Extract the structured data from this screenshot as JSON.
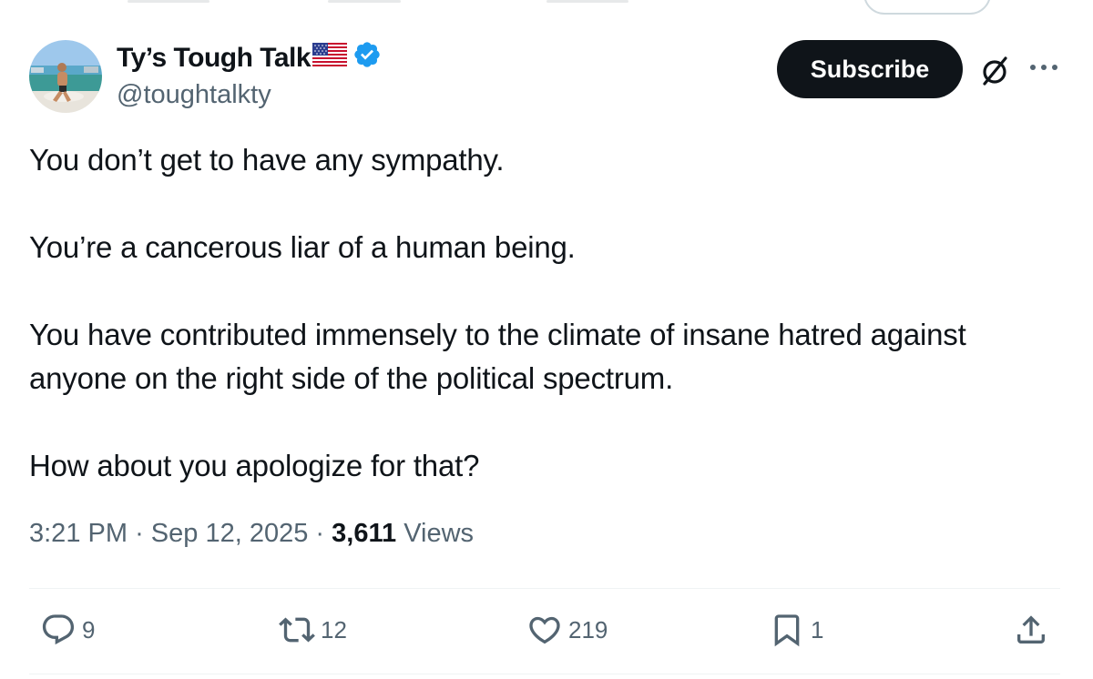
{
  "author": {
    "display_name": "Ty’s Tough Talk",
    "handle": "@toughtalkty",
    "verified": true,
    "flag_icon": "us-flag-icon"
  },
  "header": {
    "subscribe_label": "Subscribe",
    "grok_icon": "grok-icon",
    "more_icon": "more-icon"
  },
  "tweet": {
    "paragraphs": [
      "You don’t get to have any sympathy.",
      "You’re a cancerous liar of a human being.",
      "You have contributed immensely to the climate of insane hatred against anyone on the right side of the political spectrum.",
      "How about you apologize for that?"
    ]
  },
  "meta": {
    "time": "3:21 PM",
    "separator": "·",
    "date": "Sep 12, 2025",
    "views_count": "3,611",
    "views_label": "Views"
  },
  "actions": {
    "replies": "9",
    "reposts": "12",
    "likes": "219",
    "bookmarks": "1"
  },
  "colors": {
    "text": "#0f1419",
    "secondary": "#536471",
    "verified": "#1d9bf0",
    "button": "#0f1419"
  }
}
